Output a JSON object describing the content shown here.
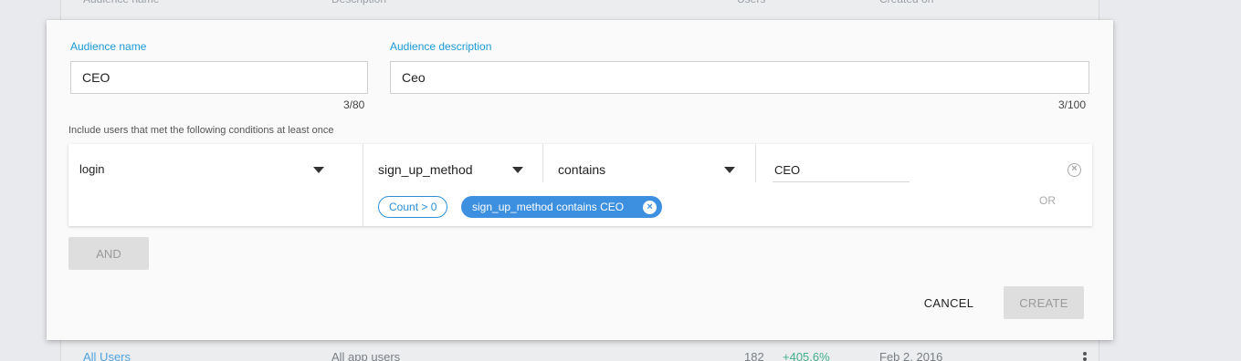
{
  "background_table": {
    "headers": {
      "name": "Audience name",
      "description": "Description",
      "users": "Users",
      "created": "Created on"
    },
    "row": {
      "name": "All Users",
      "description": "All app users",
      "users": "182",
      "change": "+405.6%",
      "created": "Feb 2, 2016"
    }
  },
  "dialog": {
    "name_label": "Audience name",
    "name_value": "CEO",
    "name_counter": "3/80",
    "description_label": "Audience description",
    "description_value": "Ceo",
    "description_counter": "3/100",
    "conditions_hint": "Include users that met the following conditions at least once",
    "condition": {
      "event": "login",
      "parameter": "sign_up_method",
      "operator": "contains",
      "value": "CEO",
      "chip_count": "Count > 0",
      "chip_filter": "sign_up_method contains CEO",
      "or_label": "OR"
    },
    "and_button": "AND",
    "cancel_button": "CANCEL",
    "create_button": "CREATE"
  },
  "colors": {
    "accent": "#1a9ad6",
    "chip": "#3d8fe0",
    "positive": "#43b08a"
  }
}
